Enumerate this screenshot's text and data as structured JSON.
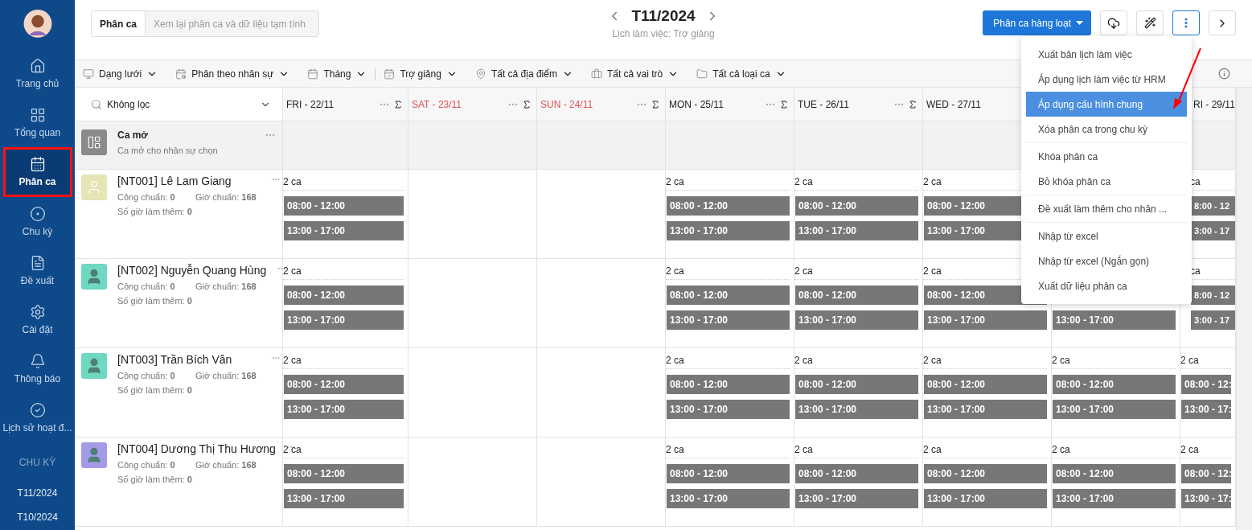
{
  "sidebar": {
    "items": [
      {
        "label": "Trang chủ",
        "selected": false
      },
      {
        "label": "Tổng quan",
        "selected": false
      },
      {
        "label": "Phân ca",
        "selected": true
      },
      {
        "label": "Chu kỳ",
        "selected": false
      },
      {
        "label": "Đề xuất",
        "selected": false
      },
      {
        "label": "Cài đặt",
        "selected": false
      },
      {
        "label": "Thông báo",
        "selected": false
      },
      {
        "label": "Lịch sử hoạt đ...",
        "selected": false
      }
    ],
    "section_title": "CHU KỲ",
    "periods": [
      {
        "label": "T11/2024"
      },
      {
        "label": "T10/2024"
      }
    ]
  },
  "header": {
    "tab_label": "Phân ca",
    "search": {
      "placeholder": "Xem lại phân ca và dữ liệu tạm tính"
    },
    "title": "T11/2024",
    "subtitle": "Lịch làm việc: Trợ giảng",
    "bulk_button": "Phân ca hàng loạt",
    "more_open": true
  },
  "filters": [
    {
      "label": "Dạng lưới",
      "separator_after": false
    },
    {
      "label": "Phân theo nhân sự",
      "separator_after": false
    },
    {
      "label": "Tháng",
      "separator_after": true
    },
    {
      "label": "Trợ giảng",
      "separator_after": false
    },
    {
      "label": "Tất cả địa điểm",
      "separator_after": false
    },
    {
      "label": "Tất cả vai trò",
      "separator_after": false
    },
    {
      "label": "Tất cả loại ca",
      "separator_after": false
    }
  ],
  "table": {
    "filter_label": "Không lọc",
    "days": [
      {
        "kind": "full",
        "label": "FRI - 22/11",
        "weekend": false
      },
      {
        "kind": "full",
        "label": "SAT - 23/11",
        "weekend": true
      },
      {
        "kind": "full",
        "label": "SUN - 24/11",
        "weekend": true
      },
      {
        "kind": "full",
        "label": "MON - 25/11",
        "weekend": false
      },
      {
        "kind": "full",
        "label": "TUE - 26/11",
        "weekend": false
      },
      {
        "kind": "label_only",
        "label": "WED - 27/11",
        "weekend": false
      },
      {
        "kind": "covered"
      },
      {
        "kind": "cut",
        "label": "RI - 29/11",
        "weekend": false
      }
    ],
    "open_shift": {
      "title": "Ca mở",
      "subtitle": "Ca mở cho nhân sự chọn"
    },
    "employees": [
      {
        "name": "[NT001] Lê Lam Giang",
        "kind": "outline",
        "color": "#e6e5b5",
        "standard_days": "Công chuẩn: **0**",
        "standard_hours": "Giờ chuẩn: **168**",
        "overtime": "Số giờ làm thêm: **0**",
        "shifts": [
          {
            "kind": "shifts",
            "count": "2 ca",
            "times": [
              "08:00 - 12:00",
              "13:00 - 17:00"
            ]
          },
          {
            "kind": "empty"
          },
          {
            "kind": "empty"
          },
          {
            "kind": "shifts",
            "count": "2 ca",
            "times": [
              "08:00 - 12:00",
              "13:00 - 17:00"
            ]
          },
          {
            "kind": "shifts",
            "count": "2 ca",
            "times": [
              "08:00 - 12:00",
              "13:00 - 17:00"
            ]
          },
          {
            "kind": "shifts",
            "count": "2 ca",
            "times": [
              "08:00 - 12:00",
              "13:00 - 17:00"
            ]
          },
          {
            "kind": "covered"
          },
          {
            "kind": "cut",
            "count": "ca",
            "times": [
              "8:00 - 12",
              "3:00 - 17"
            ]
          }
        ]
      },
      {
        "name": "[NT002] Nguyễn Quang Hùng",
        "kind": "filled",
        "color": "#6fd8c2",
        "standard_days": "Công chuẩn: **0**",
        "standard_hours": "Giờ chuẩn: **168**",
        "overtime": "Số giờ làm thêm: **0**",
        "shifts": [
          {
            "kind": "shifts",
            "count": "2 ca",
            "times": [
              "08:00 - 12:00",
              "13:00 - 17:00"
            ]
          },
          {
            "kind": "empty"
          },
          {
            "kind": "empty"
          },
          {
            "kind": "shifts",
            "count": "2 ca",
            "times": [
              "08:00 - 12:00",
              "13:00 - 17:00"
            ]
          },
          {
            "kind": "shifts",
            "count": "2 ca",
            "times": [
              "08:00 - 12:00",
              "13:00 - 17:00"
            ]
          },
          {
            "kind": "shifts",
            "count": "2 ca",
            "times": [
              "08:00 - 12:00",
              "13:00 - 17:00"
            ]
          },
          {
            "kind": "lower",
            "times": [
              "13:00 - 17:00"
            ]
          },
          {
            "kind": "cut",
            "count": "ca",
            "times": [
              "8:00 - 12",
              "3:00 - 17"
            ]
          }
        ]
      },
      {
        "name": "[NT003] Trần Bích Vân",
        "kind": "filled",
        "color": "#6fd8c2",
        "standard_days": "Công chuẩn: **0**",
        "standard_hours": "Giờ chuẩn: **168**",
        "overtime": "Số giờ làm thêm: **0**",
        "shifts": [
          {
            "kind": "shifts",
            "count": "2 ca",
            "times": [
              "08:00 - 12:00",
              "13:00 - 17:00"
            ]
          },
          {
            "kind": "empty"
          },
          {
            "kind": "empty"
          },
          {
            "kind": "shifts",
            "count": "2 ca",
            "times": [
              "08:00 - 12:00",
              "13:00 - 17:00"
            ]
          },
          {
            "kind": "shifts",
            "count": "2 ca",
            "times": [
              "08:00 - 12:00",
              "13:00 - 17:00"
            ]
          },
          {
            "kind": "shifts",
            "count": "2 ca",
            "times": [
              "08:00 - 12:00",
              "13:00 - 17:00"
            ]
          },
          {
            "kind": "shifts",
            "count": "2 ca",
            "times": [
              "08:00 - 12:00",
              "13:00 - 17:00"
            ]
          },
          {
            "kind": "shifts",
            "count": "2 ca",
            "times": [
              "08:00 - 12:",
              "13:00 - 17:"
            ]
          }
        ]
      },
      {
        "name": "[NT004] Dương Thị Thu Hương",
        "kind": "filled",
        "color": "#a39be8",
        "standard_days": "Công chuẩn: **0**",
        "standard_hours": "Giờ chuẩn: **168**",
        "overtime": "Số giờ làm thêm: **0**",
        "shifts": [
          {
            "kind": "shifts",
            "count": "2 ca",
            "times": [
              "08:00 - 12:00",
              "13:00 - 17:00"
            ]
          },
          {
            "kind": "empty"
          },
          {
            "kind": "empty"
          },
          {
            "kind": "shifts",
            "count": "2 ca",
            "times": [
              "08:00 - 12:00",
              "13:00 - 17:00"
            ]
          },
          {
            "kind": "shifts",
            "count": "2 ca",
            "times": [
              "08:00 - 12:00",
              "13:00 - 17:00"
            ]
          },
          {
            "kind": "shifts",
            "count": "2 ca",
            "times": [
              "08:00 - 12:00",
              "13:00 - 17:00"
            ]
          },
          {
            "kind": "shifts",
            "count": "2 ca",
            "times": [
              "08:00 - 12:00",
              "13:00 - 17:00"
            ]
          },
          {
            "kind": "shifts",
            "count": "2 ca",
            "times": [
              "08:00 - 12:",
              "13:00 - 17:"
            ]
          }
        ]
      }
    ]
  },
  "menu": {
    "groups": [
      {
        "items": [
          {
            "label": "Xuất bản lịch làm việc",
            "selected": false
          },
          {
            "label": "Áp dụng lịch làm việc từ HRM",
            "selected": false
          },
          {
            "label": "Áp dụng cấu hình chung",
            "selected": true
          },
          {
            "label": "Xóa phân ca trong chu kỳ",
            "selected": false
          }
        ]
      },
      {
        "items": [
          {
            "label": "Khóa phân ca",
            "selected": false
          },
          {
            "label": "Bỏ khóa phân ca",
            "selected": false
          }
        ]
      },
      {
        "items": [
          {
            "label": "Đề xuất làm thêm cho nhân ...",
            "selected": false
          }
        ]
      },
      {
        "items": [
          {
            "label": "Nhập từ excel",
            "selected": false
          },
          {
            "label": "Nhập từ excel (Ngắn gọn)",
            "selected": false
          },
          {
            "label": "Xuất dữ liệu phân ca",
            "selected": false
          }
        ]
      }
    ]
  }
}
